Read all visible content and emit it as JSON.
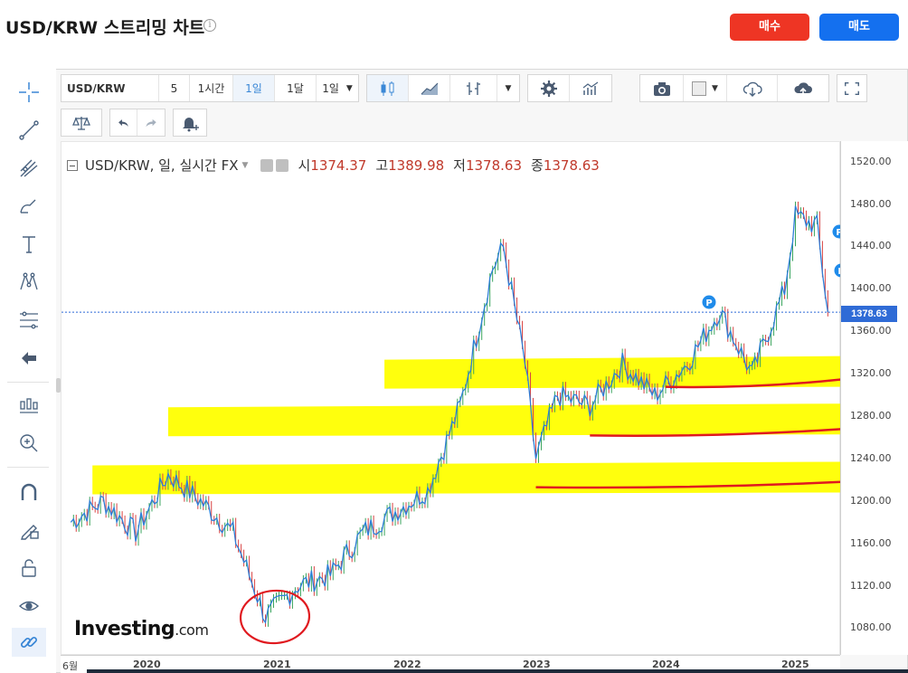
{
  "header": {
    "title": "USD/KRW 스트리밍 차트",
    "info_icon": "info-icon",
    "buy_label": "매수",
    "sell_label": "매도",
    "buy_color": "#ee3524",
    "sell_color": "#1470ef"
  },
  "left_tools": [
    {
      "name": "crosshair-icon"
    },
    {
      "name": "trend-line-icon"
    },
    {
      "name": "pitchfork-icon"
    },
    {
      "name": "brush-icon"
    },
    {
      "name": "text-icon"
    },
    {
      "name": "pattern-icon"
    },
    {
      "name": "fib-icon"
    },
    {
      "name": "arrow-left-icon"
    },
    {
      "name": "measure-icon"
    },
    {
      "name": "zoom-in-icon"
    },
    {
      "name": "magnet-icon"
    },
    {
      "name": "lock-drawing-icon"
    },
    {
      "name": "unlock-icon"
    },
    {
      "name": "eye-icon"
    },
    {
      "name": "link-icon"
    }
  ],
  "toolbar": {
    "symbol": "USD/KRW",
    "intervals": [
      "5",
      "1시간",
      "1일",
      "1달",
      "1일"
    ],
    "active_interval": "1일"
  },
  "legend": {
    "symbol": "USD/KRW, 일, 실시간 FX",
    "open_label": "시",
    "open_value": "1374.37",
    "high_label": "고",
    "high_value": "1389.98",
    "low_label": "저",
    "low_value": "1378.63",
    "close_label": "종",
    "close_value": "1378.63"
  },
  "price_axis": {
    "ticks": [
      "1520.00",
      "1480.00",
      "1440.00",
      "1400.00",
      "1360.00",
      "1320.00",
      "1280.00",
      "1240.00",
      "1200.00",
      "1160.00",
      "1120.00",
      "1080.00"
    ],
    "last_price": "1378.63"
  },
  "time_axis": {
    "ticks": [
      "6월",
      "2020",
      "2021",
      "2022",
      "2023",
      "2024",
      "2025"
    ]
  },
  "logo": {
    "main": "Investing",
    "suffix": ".com"
  },
  "chart_data": {
    "type": "line",
    "ylim": [
      1060,
      1530
    ],
    "x": [
      "2019-06",
      "2019-09",
      "2019-12",
      "2020-03",
      "2020-06",
      "2020-09",
      "2020-12",
      "2021-03",
      "2021-06",
      "2021-09",
      "2021-12",
      "2022-03",
      "2022-06",
      "2022-09",
      "2022-10",
      "2022-12",
      "2023-01",
      "2023-03",
      "2023-06",
      "2023-09",
      "2023-12",
      "2024-03",
      "2024-06",
      "2024-09",
      "2024-12",
      "2025-01",
      "2025-03",
      "2025-04"
    ],
    "series": [
      {
        "values": [
          1180,
          1200,
          1170,
          1225,
          1200,
          1170,
          1090,
          1120,
          1130,
          1170,
          1190,
          1210,
          1290,
          1420,
          1440,
          1330,
          1240,
          1300,
          1290,
          1330,
          1300,
          1330,
          1380,
          1320,
          1400,
          1470,
          1460,
          1378.63
        ]
      }
    ],
    "line_color": "#2e7ed8",
    "up_color": "#3aa55d",
    "down_color": "#d84242",
    "annotations": {
      "support_bands": [
        {
          "y": 1320,
          "from": "2021-11",
          "to": "2025-04"
        },
        {
          "y": 1275,
          "from": "2020-03",
          "to": "2025-04"
        },
        {
          "y": 1220,
          "from": "2019-08",
          "to": "2025-04"
        }
      ],
      "band_color": "#ffff00",
      "red_lines": [
        {
          "y": [
            1308,
            1315
          ],
          "from": "2024-01",
          "to": "2025-04"
        },
        {
          "y": [
            1262,
            1268
          ],
          "from": "2023-06",
          "to": "2025-04"
        },
        {
          "y": [
            1213,
            1218
          ],
          "from": "2023-01",
          "to": "2025-04"
        }
      ],
      "red_color": "#e0191f",
      "circle_label": "2021 low"
    }
  }
}
